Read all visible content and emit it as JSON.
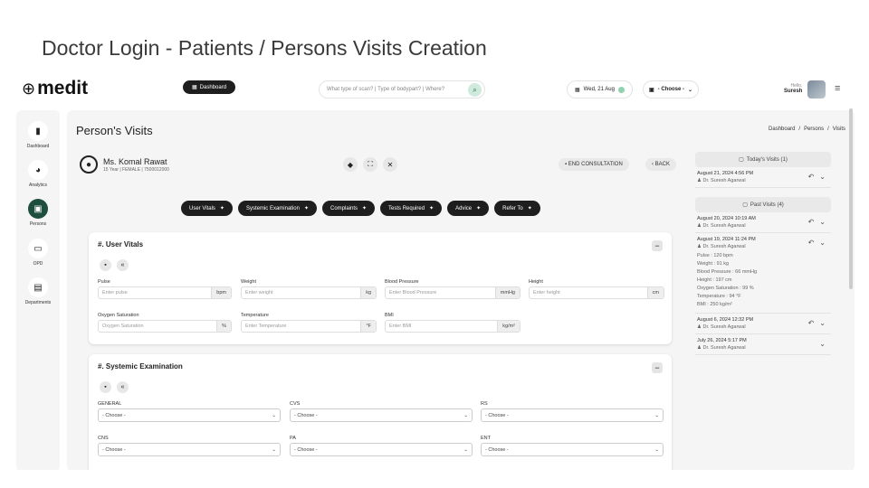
{
  "slide_title": "Doctor Login - Patients / Persons Visits Creation",
  "header": {
    "logo": "medit",
    "dashboard_btn": "Dashboard",
    "search_placeholder": "What type of scan? | Type of bodypart? | Where?",
    "date": "Wed, 21 Aug",
    "choose": "- Choose -",
    "hello": "Hello,",
    "user": "Suresh"
  },
  "sidebar": [
    {
      "label": "Dashboard",
      "icon": "bar-chart-icon"
    },
    {
      "label": "Analytics",
      "icon": "pie-chart-icon"
    },
    {
      "label": "Persons",
      "icon": "persons-icon"
    },
    {
      "label": "OPD",
      "icon": "bed-icon"
    },
    {
      "label": "Departments",
      "icon": "departments-icon"
    }
  ],
  "page": {
    "title": "Person's Visits",
    "breadcrumb": [
      "Dashboard",
      "/",
      "Persons",
      "/",
      "Visits"
    ]
  },
  "patient": {
    "name": "Ms. Komal Rawat",
    "info": "15 Year | FEMALE | 7500012000"
  },
  "buttons": {
    "end": "END CONSULTATION",
    "back": "BACK"
  },
  "tabs": [
    "User Vitals",
    "Systemic Examination",
    "Complaints",
    "Tests Required",
    "Advice",
    "Refer To"
  ],
  "vitals": {
    "title": "#. User Vitals",
    "fields": [
      {
        "label": "Pulse",
        "placeholder": "Enter pulse",
        "unit": "bpm"
      },
      {
        "label": "Weight",
        "placeholder": "Enter weight",
        "unit": "kg"
      },
      {
        "label": "Blood Pressure",
        "placeholder": "Enter Blood Pressure",
        "unit": "mmHg"
      },
      {
        "label": "Height",
        "placeholder": "Enter height",
        "unit": "cm"
      },
      {
        "label": "Oxygen Saturation",
        "placeholder": "Oxygen Saturation",
        "unit": "%"
      },
      {
        "label": "Temperature",
        "placeholder": "Enter Temperature",
        "unit": "°F"
      },
      {
        "label": "BMI",
        "placeholder": "Enter BMI",
        "unit": "kg/m²"
      }
    ]
  },
  "systemic": {
    "title": "#. Systemic Examination",
    "fields": [
      {
        "label": "GENERAL",
        "value": "- Choose -"
      },
      {
        "label": "CVS",
        "value": "- Choose -"
      },
      {
        "label": "RS",
        "value": "- Choose -"
      },
      {
        "label": "CNS",
        "value": "- Choose -"
      },
      {
        "label": "PA",
        "value": "- Choose -"
      },
      {
        "label": "ENT",
        "value": "- Choose -"
      }
    ]
  },
  "today": {
    "heading": "Today's Visits (1)",
    "items": [
      {
        "date": "August 21, 2024 4:56 PM",
        "doctor": "Dr. Suresh Agarwal"
      }
    ]
  },
  "past": {
    "heading": "Past Visits (4)",
    "items": [
      {
        "date": "August 20, 2024 10:19 AM",
        "doctor": "Dr. Suresh Agarwal",
        "details": []
      },
      {
        "date": "August 19, 2024 11:24 PM",
        "doctor": "Dr. Suresh Agarwal",
        "details": [
          "Pulse : 120 bpm",
          "Weight : 91 kg",
          "Blood Pressure : 66 mmHg",
          "Height : 197 cm",
          "Oxygen Saturation : 99 %",
          "Temperature : 94 °F",
          "BMI : 250 kg/m²"
        ]
      },
      {
        "date": "August 6, 2024 12:32 PM",
        "doctor": "Dr. Suresh Agarwal",
        "details": []
      },
      {
        "date": "July 26, 2024 5:17 PM",
        "doctor": "Dr. Suresh Agarwal",
        "details": []
      }
    ]
  },
  "colors": {
    "accent": "#1e4e3d",
    "dark": "#1e1e1e",
    "panel": "#f5f5f5"
  }
}
